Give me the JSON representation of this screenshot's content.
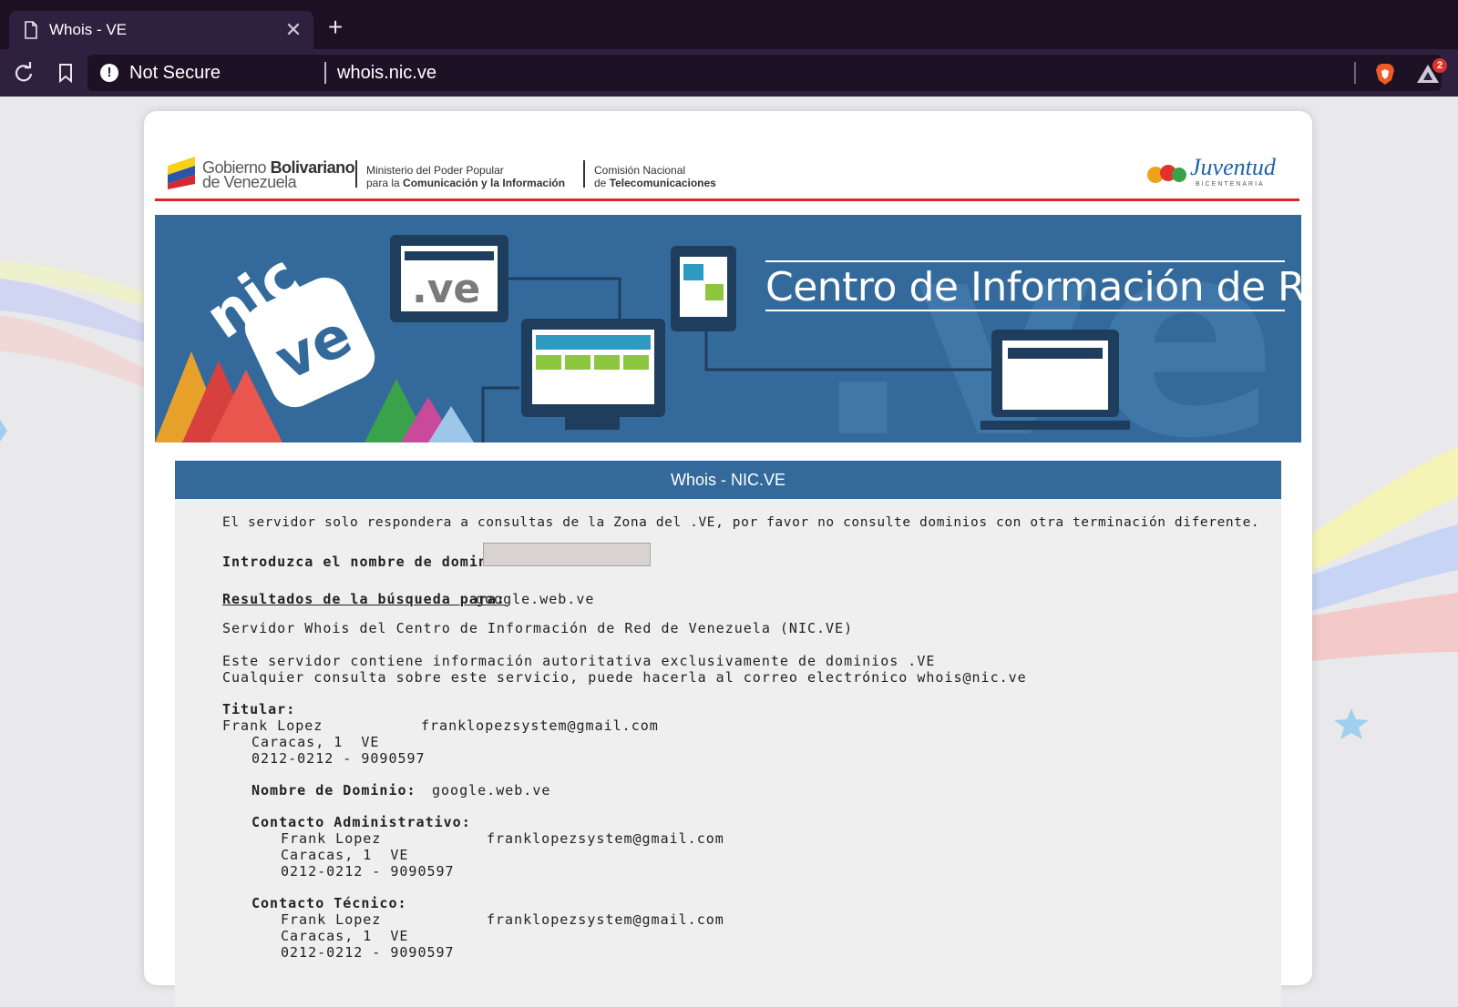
{
  "browser": {
    "tab_title": "Whois - VE",
    "tab_close": "✕",
    "new_tab": "+",
    "security_label": "Not Secure",
    "url": "whois.nic.ve",
    "rewards_badge_count": "2"
  },
  "gov_header": {
    "gov_line1_light": "Gobierno ",
    "gov_line1_bold": "Bolivariano",
    "gov_line2": "de Venezuela",
    "ministry_line1": "Ministerio del Poder Popular",
    "ministry_line2_light": "para la ",
    "ministry_line2_bold": "Comunicación y la Información",
    "conatel_line1": "Comisión Nacional",
    "conatel_line2_light": "de ",
    "conatel_line2_bold": "Telecomunicaciones",
    "juventud_logo_text": "Juventud",
    "juventud_sub": "BICENTENARIA"
  },
  "banner": {
    "title": "Centro de Información de Red",
    "logo_text_nic": "nic",
    "logo_text_ve": "ve",
    "device_label": ".ve",
    "bg_text": ".ve"
  },
  "whois": {
    "header": "Whois - NIC.VE",
    "notice": "El servidor solo respondera a consultas de la Zona del .VE, por favor no consulte dominios con otra terminación diferente.",
    "domain_label": "Introduzca el nombre de dominio:",
    "domain_input_value": "",
    "results_label": "Resultados de la búsqueda para:",
    "results_value": "google.web.ve",
    "server_line": "Servidor Whois del Centro de Información de Red de Venezuela (NIC.VE)",
    "info_line1": "Este servidor contiene información autoritativa exclusivamente de dominios .VE",
    "info_line2": "Cualquier consulta sobre este servicio, puede hacerla al correo electrónico whois@nic.ve",
    "titular_label": "Titular:",
    "titular_name": "Frank Lopez",
    "titular_email": "franklopezsystem@gmail.com",
    "titular_city": "Caracas, 1  VE",
    "titular_phone": "0212-0212 - 9090597",
    "domain_name_label": "Nombre de Dominio:",
    "domain_name_value": "google.web.ve",
    "admin_label": "Contacto Administrativo:",
    "admin_name": "Frank Lopez",
    "admin_email": "franklopezsystem@gmail.com",
    "admin_city": "Caracas, 1  VE",
    "admin_phone": "0212-0212 - 9090597",
    "tech_label": "Contacto Técnico:",
    "tech_name": "Frank Lopez",
    "tech_email": "franklopezsystem@gmail.com",
    "tech_city": "Caracas, 1  VE",
    "tech_phone": "0212-0212 - 9090597"
  },
  "colors": {
    "browser_tabbar": "#1e1022",
    "browser_toolbar": "#2e2140",
    "nic_blue": "#336a9b",
    "gov_red": "#d8262b"
  },
  "icons": [
    "page-icon",
    "close-icon",
    "plus-icon",
    "reload-icon",
    "bookmark-icon",
    "warning-icon",
    "brave-lion-icon",
    "brave-rewards-icon"
  ]
}
